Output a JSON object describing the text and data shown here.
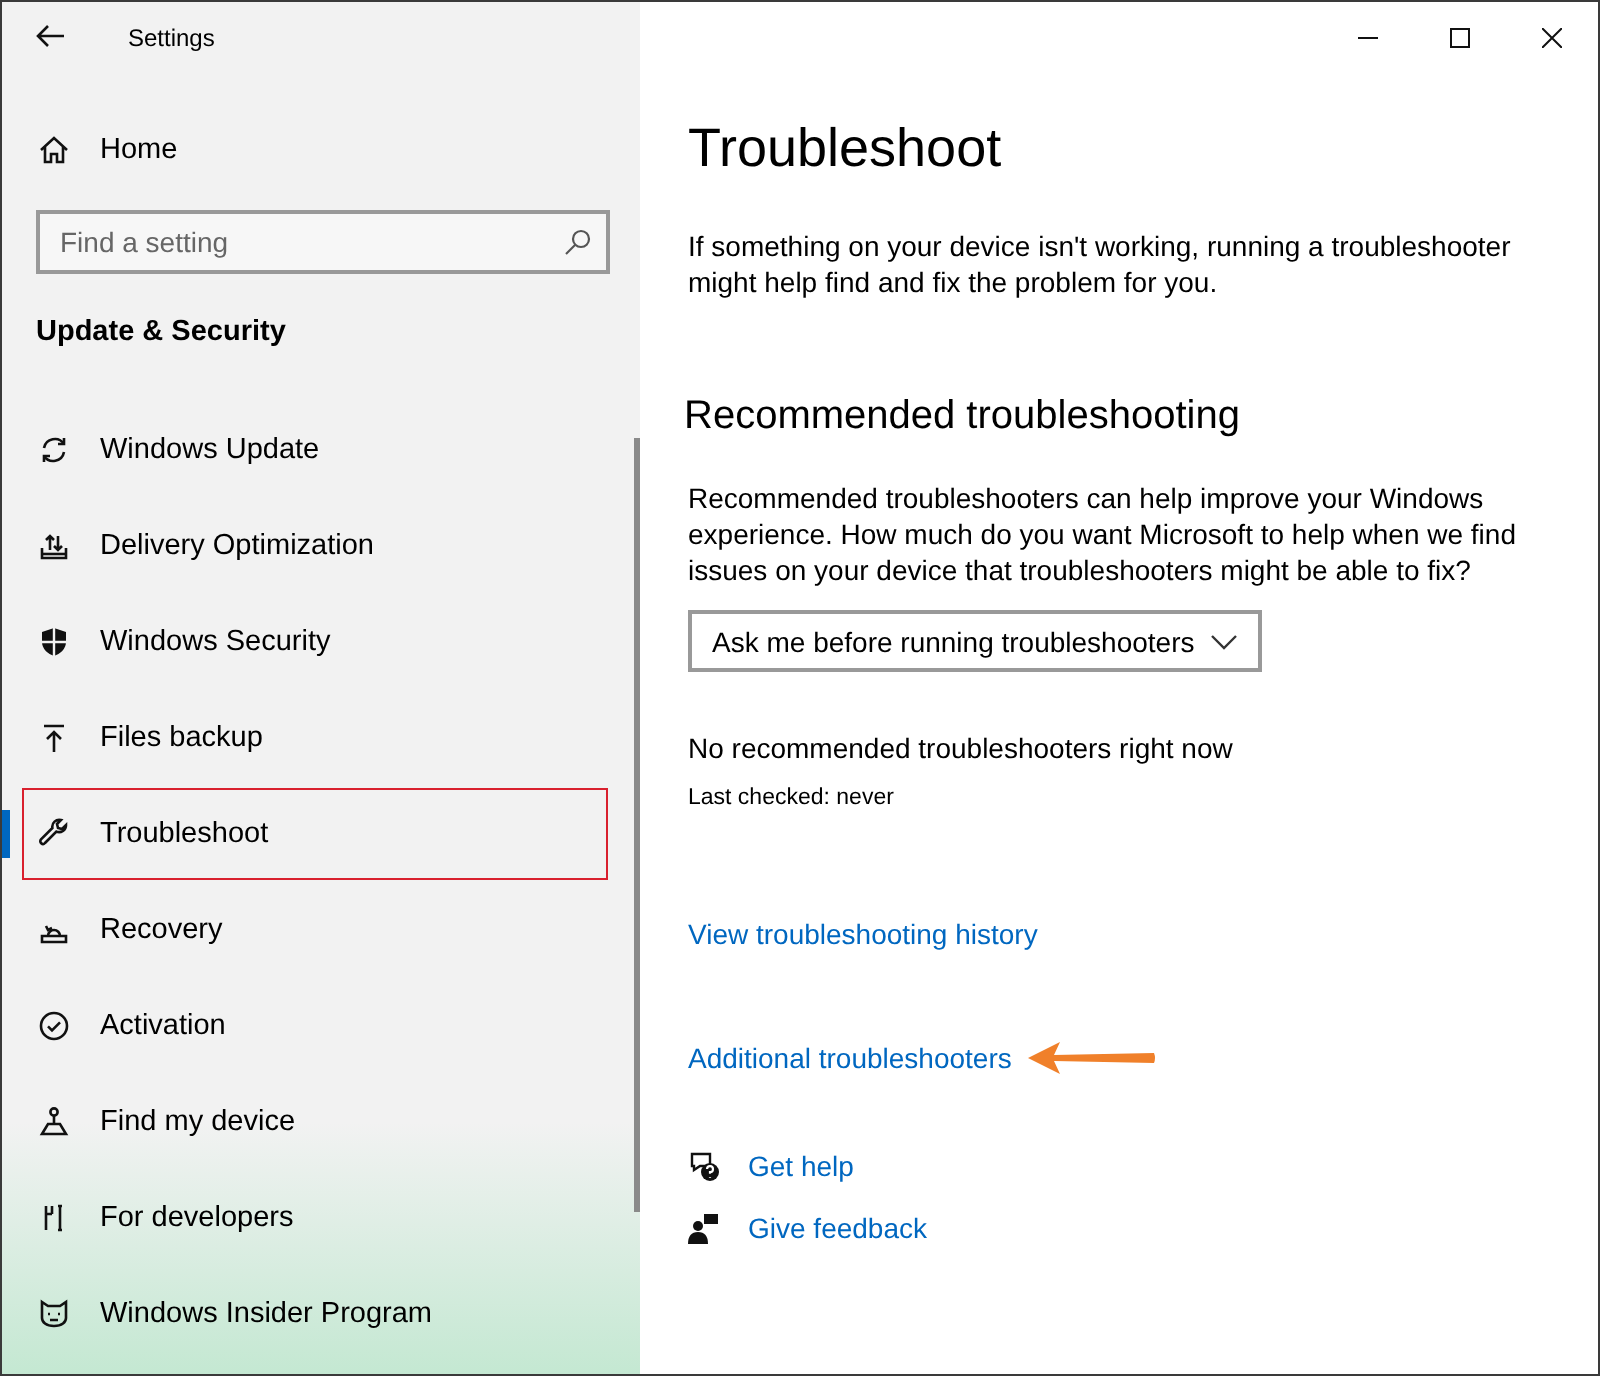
{
  "window": {
    "title": "Settings"
  },
  "sidebar": {
    "home": "Home",
    "search": {
      "placeholder": "Find a setting"
    },
    "section": "Update & Security",
    "items": [
      {
        "label": "Windows Update",
        "selected": false,
        "highlighted": false
      },
      {
        "label": "Delivery Optimization",
        "selected": false,
        "highlighted": false
      },
      {
        "label": "Windows Security",
        "selected": false,
        "highlighted": false
      },
      {
        "label": "Files backup",
        "selected": false,
        "highlighted": false
      },
      {
        "label": "Troubleshoot",
        "selected": true,
        "highlighted": true
      },
      {
        "label": "Recovery",
        "selected": false,
        "highlighted": false
      },
      {
        "label": "Activation",
        "selected": false,
        "highlighted": false
      },
      {
        "label": "Find my device",
        "selected": false,
        "highlighted": false
      },
      {
        "label": "For developers",
        "selected": false,
        "highlighted": false
      },
      {
        "label": "Windows Insider Program",
        "selected": false,
        "highlighted": false
      }
    ]
  },
  "content": {
    "title": "Troubleshoot",
    "intro": "If something on your device isn't working, running a troubleshooter might help find and fix the problem for you.",
    "heading": "Recommended troubleshooting",
    "description": "Recommended troubleshooters can help improve your Windows experience. How much do you want Microsoft to help when we find issues on your device that troubleshooters might be able to fix?",
    "dropdown": {
      "value": "Ask me before running troubleshooters"
    },
    "status": "No recommended troubleshooters right now",
    "last_checked": "Last checked: never",
    "links": [
      {
        "label": "View troubleshooting history",
        "arrow": false
      },
      {
        "label": "Additional troubleshooters",
        "arrow": true
      }
    ],
    "help_links": [
      {
        "label": "Get help"
      },
      {
        "label": "Give feedback"
      }
    ]
  }
}
